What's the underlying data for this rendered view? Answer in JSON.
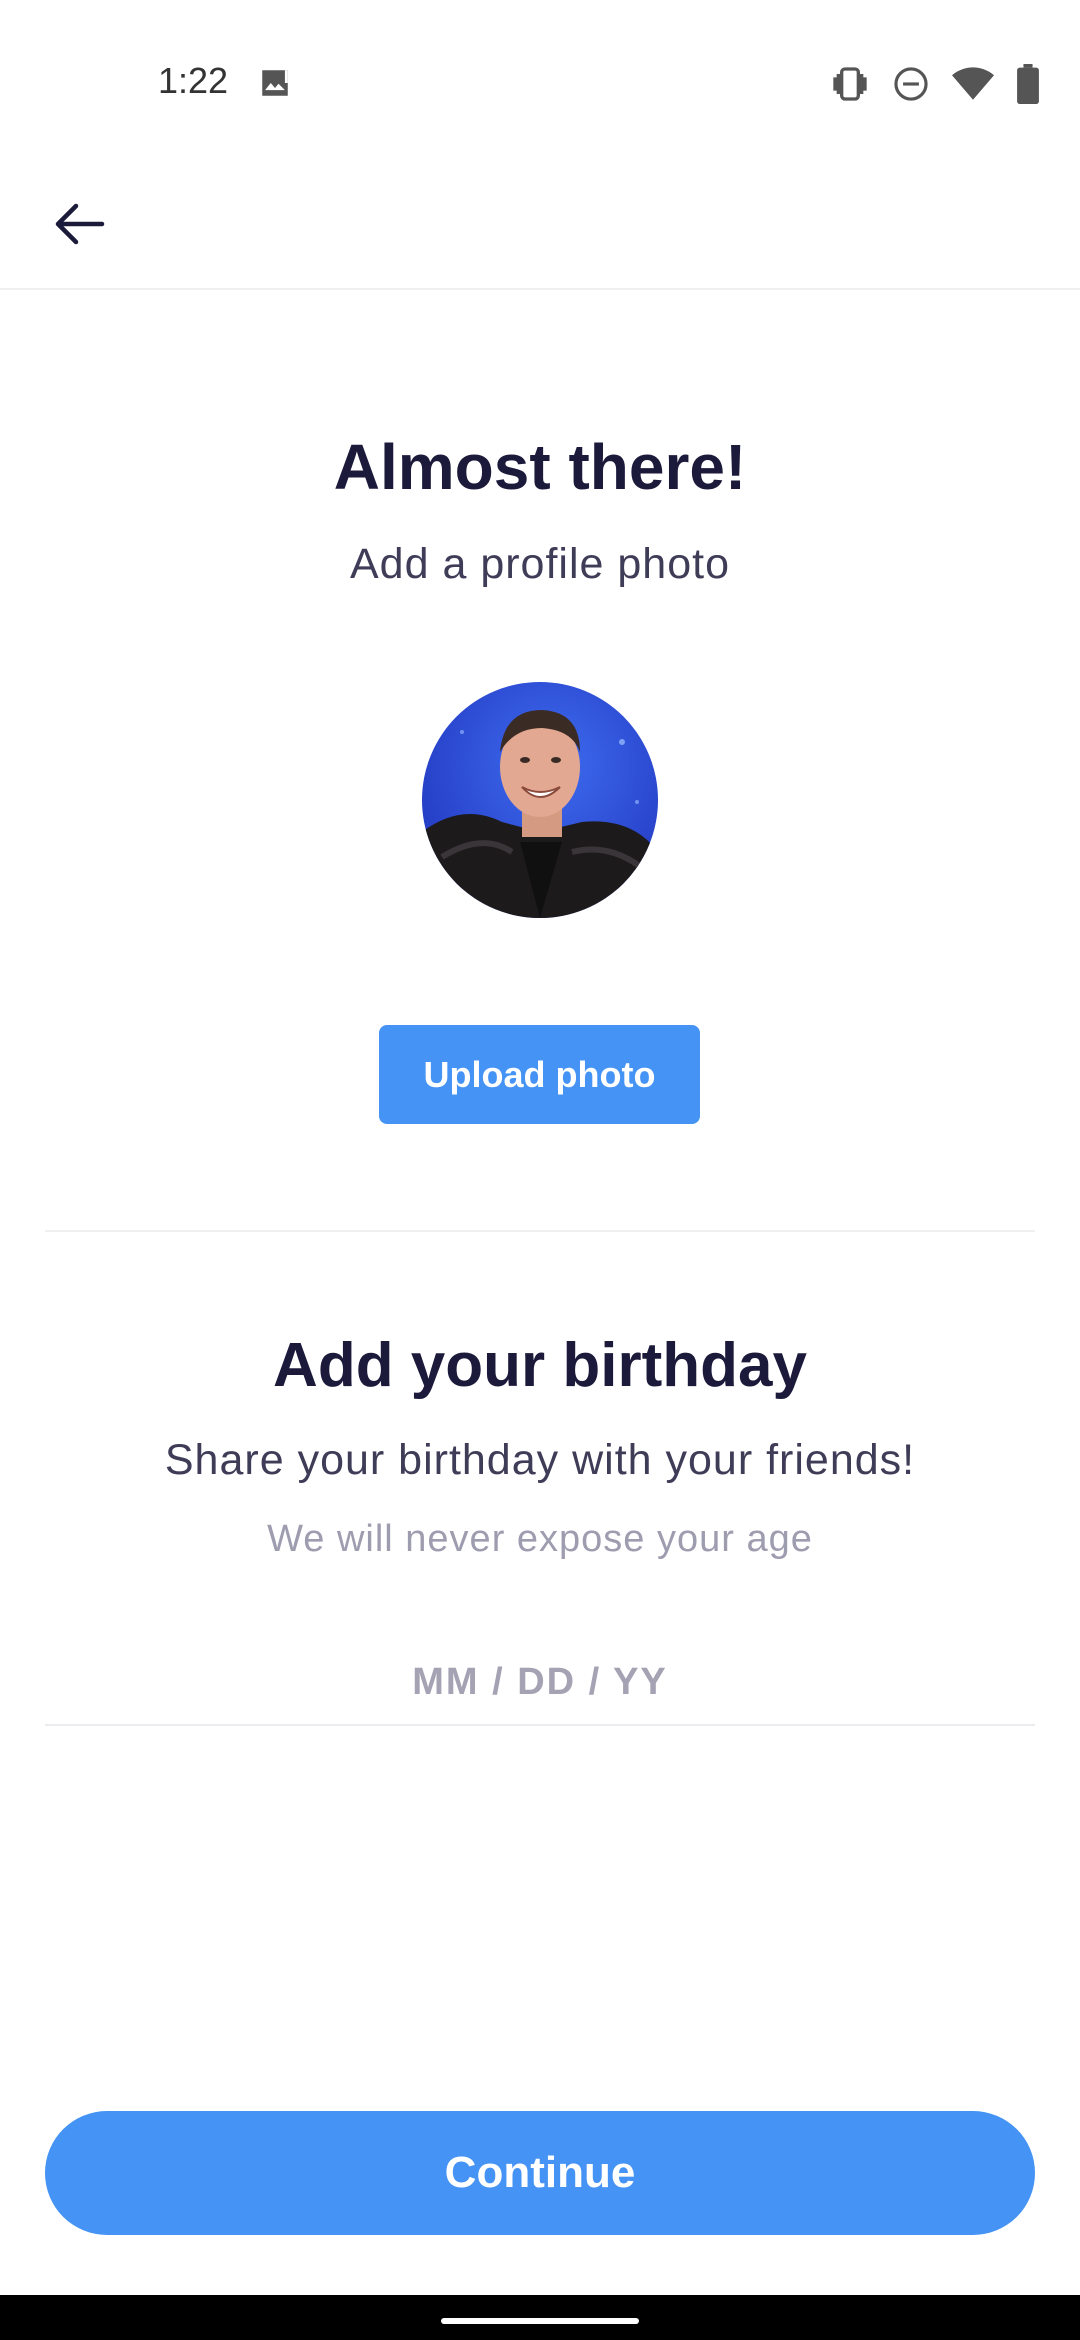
{
  "status_bar": {
    "time": "1:22",
    "icons": [
      "image-notification-icon",
      "vibrate-icon",
      "do-not-disturb-icon",
      "wifi-icon",
      "battery-icon"
    ]
  },
  "app_bar": {
    "back_icon": "arrow-left-icon"
  },
  "profile_section": {
    "title": "Almost there!",
    "subtitle": "Add a profile photo",
    "upload_button_label": "Upload photo"
  },
  "birthday_section": {
    "title": "Add your birthday",
    "subtitle": "Share your birthday with your friends!",
    "hint": "We will never expose your age",
    "input_value": "",
    "input_placeholder": "MM / DD / YY"
  },
  "footer": {
    "continue_label": "Continue"
  },
  "colors": {
    "accent": "#4593f4",
    "title": "#1c1a3a",
    "subtitle": "#3e3c57",
    "hint": "#9e9caf"
  }
}
